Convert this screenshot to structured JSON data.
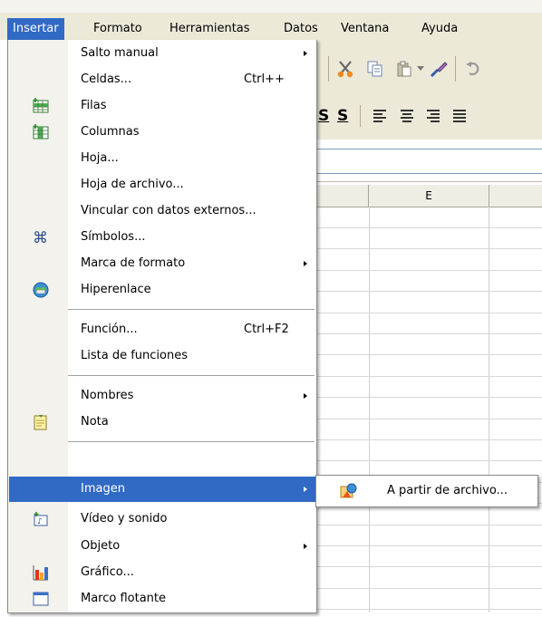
{
  "menubar": {
    "items": [
      {
        "label": "Insertar",
        "active": true
      },
      {
        "label": "Formato"
      },
      {
        "label": "Herramientas"
      },
      {
        "label": "Datos"
      },
      {
        "label": "Ventana"
      },
      {
        "label": "Ayuda"
      }
    ]
  },
  "sheet": {
    "column_header": "E"
  },
  "insert_menu": {
    "items": [
      {
        "label": "Salto manual",
        "submenu": true
      },
      {
        "label": "Celdas...",
        "shortcut": "Ctrl++"
      },
      {
        "label": "Filas",
        "icon": "insert-rows-icon"
      },
      {
        "label": "Columnas",
        "icon": "insert-columns-icon"
      },
      {
        "label": "Hoja..."
      },
      {
        "label": "Hoja de archivo..."
      },
      {
        "label": "Vincular con datos externos..."
      },
      {
        "label": "Símbolos...",
        "icon": "symbols-icon"
      },
      {
        "label": "Marca de formato",
        "submenu": true
      },
      {
        "label": "Hiperenlace",
        "icon": "hyperlink-icon"
      },
      {
        "label": "Función...",
        "shortcut": "Ctrl+F2"
      },
      {
        "label": "Lista de funciones"
      },
      {
        "label": "Nombres",
        "submenu": true
      },
      {
        "label": "Nota",
        "icon": "note-icon"
      },
      {
        "label": "Imagen",
        "submenu": true,
        "highlighted": true
      },
      {
        "label": "Vídeo y sonido",
        "icon": "video-sound-icon"
      },
      {
        "label": "Objeto",
        "submenu": true
      },
      {
        "label": "Gráfico...",
        "icon": "chart-icon"
      },
      {
        "label": "Marco flotante",
        "icon": "floating-frame-icon"
      }
    ]
  },
  "image_submenu": {
    "items": [
      {
        "label": "A partir de archivo...",
        "icon": "image-from-file-icon"
      }
    ]
  },
  "colors": {
    "highlight": "#316ac5",
    "menubar_bg": "#ece9d8",
    "menu_gutter": "#f3f2ec"
  }
}
